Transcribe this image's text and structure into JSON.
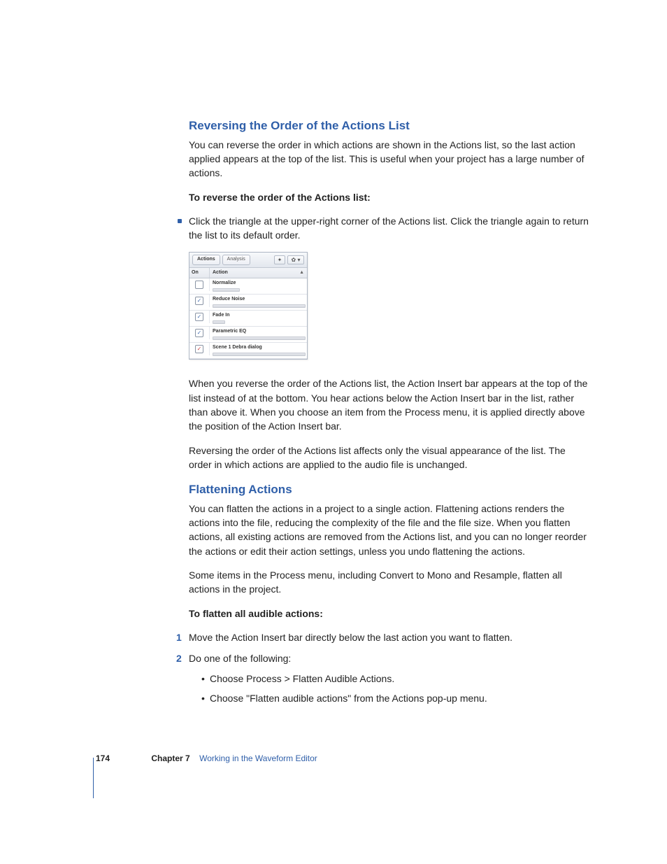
{
  "section1": {
    "heading": "Reversing the Order of the Actions List",
    "intro": "You can reverse the order in which actions are shown in the Actions list, so the last action applied appears at the top of the list. This is useful when your project has a large number of actions.",
    "howto_label": "To reverse the order of the Actions list:",
    "step1": "Click the triangle at the upper-right corner of the Actions list. Click the triangle again to return the list to its default order.",
    "para2": "When you reverse the order of the Actions list, the Action Insert bar appears at the top of the list instead of at the bottom. You hear actions below the Action Insert bar in the list, rather than above it. When you choose an item from the Process menu, it is applied directly above the position of the Action Insert bar.",
    "para3": "Reversing the order of the Actions list affects only the visual appearance of the list. The order in which actions are applied to the audio file is unchanged."
  },
  "panel": {
    "tabs": {
      "actions": "Actions",
      "analysis": "Analysis"
    },
    "add_glyph": "✦",
    "gear_glyph": "✿",
    "dd_glyph": "▾",
    "sort_glyph": "▲",
    "col_on": "On",
    "col_action": "Action",
    "rows": [
      {
        "label": "Normalize",
        "checked": false,
        "bar_w": "28%"
      },
      {
        "label": "Reduce Noise",
        "checked": true,
        "bar_w": "100%"
      },
      {
        "label": "Fade In",
        "checked": true,
        "bar_w": "12%"
      },
      {
        "label": "Parametric EQ",
        "checked": true,
        "bar_w": "100%"
      },
      {
        "label": "Scene 1 Debra dialog",
        "checked": true,
        "bar_w": "100%",
        "red": true
      }
    ]
  },
  "section2": {
    "heading": "Flattening Actions",
    "intro": "You can flatten the actions in a project to a single action. Flattening actions renders the actions into the file, reducing the complexity of the file and the file size. When you flatten actions, all existing actions are removed from the Actions list, and you can no longer reorder the actions or edit their action settings, unless you undo flattening the actions.",
    "para2": "Some items in the Process menu, including Convert to Mono and Resample, flatten all actions in the project.",
    "howto_label": "To flatten all audible actions:",
    "step1": "Move the Action Insert bar directly below the last action you want to flatten.",
    "step2": "Do one of the following:",
    "sub1": "Choose Process > Flatten Audible Actions.",
    "sub2": "Choose \"Flatten audible actions\" from the Actions pop-up menu."
  },
  "footer": {
    "page": "174",
    "chapter": "Chapter 7",
    "title": "Working in the Waveform Editor"
  }
}
